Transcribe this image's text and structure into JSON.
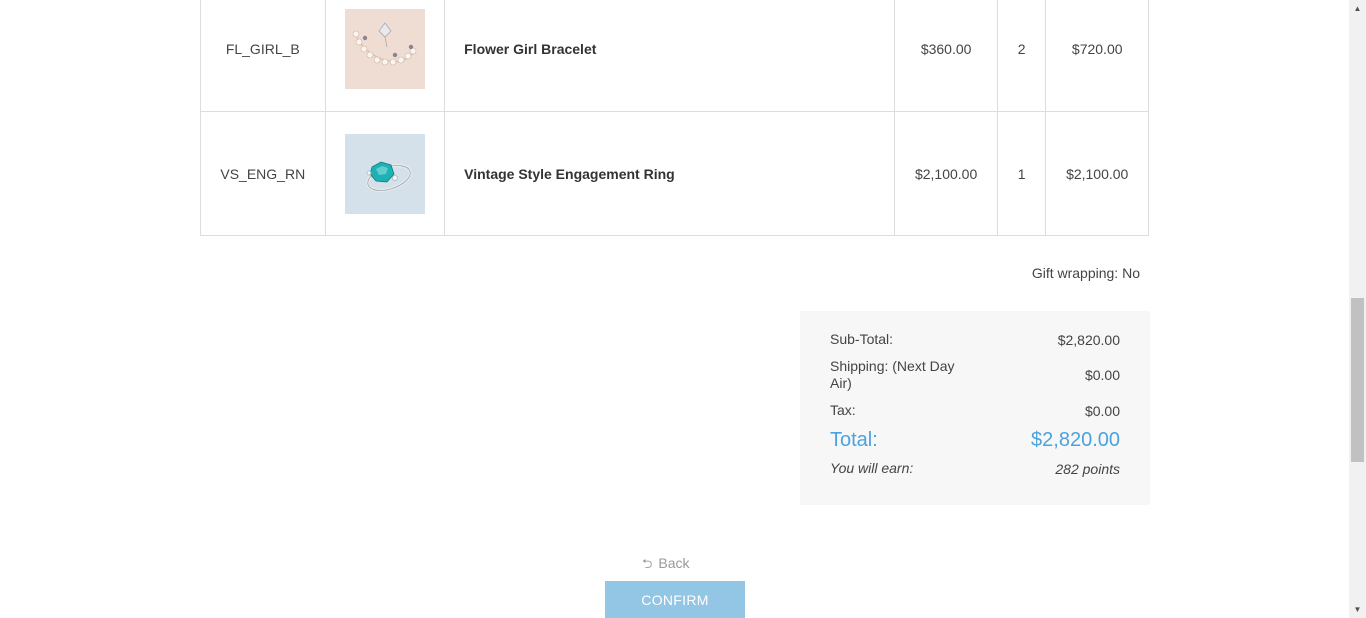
{
  "cart": {
    "items": [
      {
        "sku": "FL_GIRL_B",
        "name": "Flower Girl Bracelet",
        "price": "$360.00",
        "qty": "2",
        "total": "$720.00",
        "image": "bracelet-image"
      },
      {
        "sku": "VS_ENG_RN",
        "name": "Vintage Style Engagement Ring",
        "price": "$2,100.00",
        "qty": "1",
        "total": "$2,100.00",
        "image": "ring-image"
      }
    ],
    "gift_wrapping": "Gift wrapping: No"
  },
  "totals": {
    "subtotal_label": "Sub-Total:",
    "subtotal_value": "$2,820.00",
    "shipping_label": "Shipping: (Next Day Air)",
    "shipping_value": "$0.00",
    "tax_label": "Tax:",
    "tax_value": "$0.00",
    "total_label": "Total:",
    "total_value": "$2,820.00",
    "earn_label": "You will earn:",
    "earn_value": "282 points"
  },
  "actions": {
    "back_label": "Back",
    "back_icon": "return-arrow-icon",
    "confirm_label": "CONFIRM"
  },
  "colors": {
    "accent": "#4aa3df",
    "confirm_button": "#93c5e4",
    "summary_background": "#f7f7f7"
  }
}
